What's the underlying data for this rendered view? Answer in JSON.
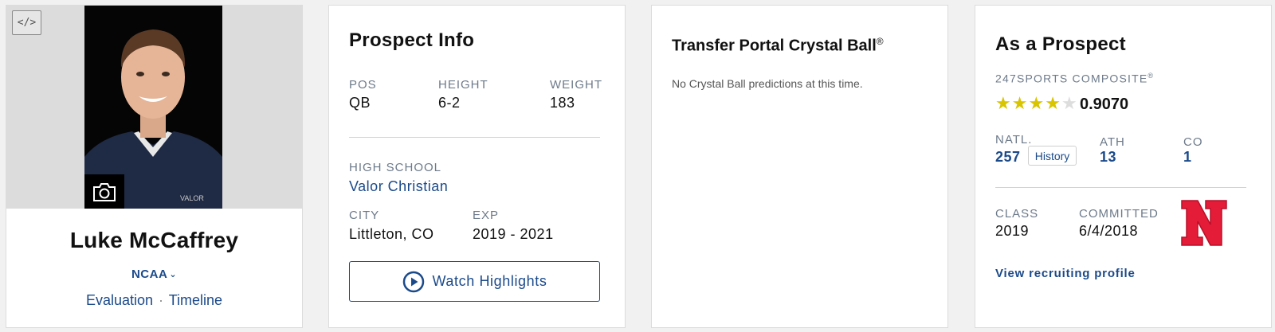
{
  "player": {
    "name": "Luke McCaffrey",
    "league": "NCAA",
    "links": {
      "evaluation": "Evaluation",
      "separator": "·",
      "timeline": "Timeline"
    }
  },
  "prospect_info": {
    "title": "Prospect Info",
    "pos_label": "POS",
    "pos": "QB",
    "height_label": "HEIGHT",
    "height": "6-2",
    "weight_label": "WEIGHT",
    "weight": "183",
    "high_school_label": "HIGH SCHOOL",
    "high_school": "Valor Christian",
    "city_label": "CITY",
    "city": "Littleton, CO",
    "exp_label": "EXP",
    "exp": "2019 - 2021",
    "watch_label": "Watch Highlights"
  },
  "crystal_ball": {
    "title": "Transfer Portal Crystal Ball",
    "reg": "®",
    "message": "No Crystal Ball predictions at this time."
  },
  "as_prospect": {
    "title": "As a Prospect",
    "composite_label": "247SPORTS COMPOSITE",
    "composite_reg": "®",
    "stars": 4,
    "max_stars": 5,
    "rating": "0.9070",
    "natl_label": "NATL.",
    "natl": "257",
    "history_label": "History",
    "pos_label": "ATH",
    "pos_rank": "13",
    "state_label": "CO",
    "state_rank": "1",
    "class_label": "CLASS",
    "class": "2019",
    "committed_label": "COMMITTED",
    "committed": "6/4/2018",
    "view_link": "View recruiting profile"
  },
  "colors": {
    "link": "#1b4a8a",
    "label": "#6d7a8a",
    "star_on": "#d9c400",
    "star_off": "#dddddd",
    "nebraska_red": "#e41c38"
  },
  "icons": {
    "embed": "embed-code-icon",
    "camera": "camera-icon",
    "chevron": "chevron-down-icon",
    "play": "play-circle-icon",
    "team_logo": "nebraska-n-logo"
  }
}
